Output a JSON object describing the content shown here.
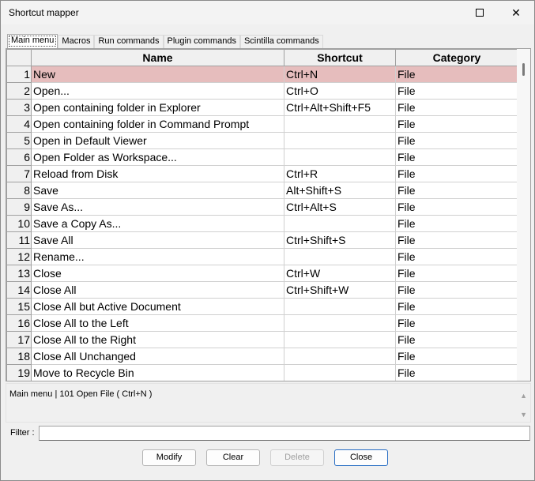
{
  "window": {
    "title": "Shortcut mapper",
    "close_glyph": "✕"
  },
  "tabs": [
    {
      "label": "Main menu",
      "active": true
    },
    {
      "label": "Macros",
      "active": false
    },
    {
      "label": "Run commands",
      "active": false
    },
    {
      "label": "Plugin commands",
      "active": false
    },
    {
      "label": "Scintilla commands",
      "active": false
    }
  ],
  "grid": {
    "headers": {
      "name": "Name",
      "shortcut": "Shortcut",
      "category": "Category"
    },
    "selected_row": 0,
    "selection_color": "#e6bdbd",
    "rows": [
      {
        "num": "1",
        "name": "New",
        "shortcut": "Ctrl+N",
        "category": "File"
      },
      {
        "num": "2",
        "name": "Open...",
        "shortcut": "Ctrl+O",
        "category": "File"
      },
      {
        "num": "3",
        "name": "Open containing folder in Explorer",
        "shortcut": "Ctrl+Alt+Shift+F5",
        "category": "File"
      },
      {
        "num": "4",
        "name": "Open containing folder in Command Prompt",
        "shortcut": "",
        "category": "File"
      },
      {
        "num": "5",
        "name": "Open in Default Viewer",
        "shortcut": "",
        "category": "File"
      },
      {
        "num": "6",
        "name": "Open Folder as Workspace...",
        "shortcut": "",
        "category": "File"
      },
      {
        "num": "7",
        "name": "Reload from Disk",
        "shortcut": "Ctrl+R",
        "category": "File"
      },
      {
        "num": "8",
        "name": "Save",
        "shortcut": "Alt+Shift+S",
        "category": "File"
      },
      {
        "num": "9",
        "name": "Save As...",
        "shortcut": "Ctrl+Alt+S",
        "category": "File"
      },
      {
        "num": "10",
        "name": "Save a Copy As...",
        "shortcut": "",
        "category": "File"
      },
      {
        "num": "11",
        "name": "Save All",
        "shortcut": "Ctrl+Shift+S",
        "category": "File"
      },
      {
        "num": "12",
        "name": "Rename...",
        "shortcut": "",
        "category": "File"
      },
      {
        "num": "13",
        "name": "Close",
        "shortcut": "Ctrl+W",
        "category": "File"
      },
      {
        "num": "14",
        "name": "Close All",
        "shortcut": "Ctrl+Shift+W",
        "category": "File"
      },
      {
        "num": "15",
        "name": "Close All but Active Document",
        "shortcut": "",
        "category": "File"
      },
      {
        "num": "16",
        "name": "Close All to the Left",
        "shortcut": "",
        "category": "File"
      },
      {
        "num": "17",
        "name": "Close All to the Right",
        "shortcut": "",
        "category": "File"
      },
      {
        "num": "18",
        "name": "Close All Unchanged",
        "shortcut": "",
        "category": "File"
      },
      {
        "num": "19",
        "name": "Move to Recycle Bin",
        "shortcut": "",
        "category": "File"
      }
    ]
  },
  "info": {
    "text": "Main menu  |  101   Open File   ( Ctrl+N )",
    "up_glyph": "▲",
    "down_glyph": "▼"
  },
  "filter": {
    "label": "Filter :",
    "value": ""
  },
  "buttons": {
    "modify": "Modify",
    "clear": "Clear",
    "delete": "Delete",
    "close": "Close"
  }
}
